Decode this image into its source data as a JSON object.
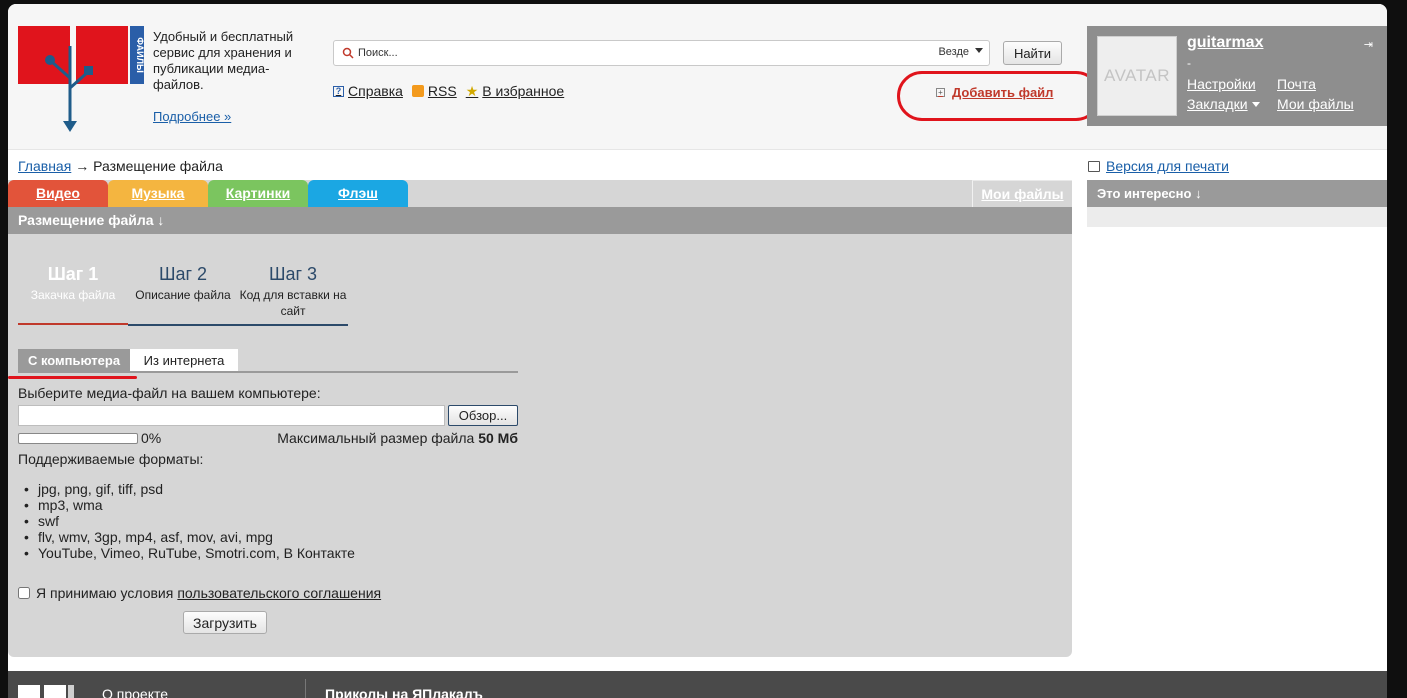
{
  "colors": {
    "accent_red": "#c0392b",
    "highlight_red": "#e0141c",
    "tab_video": "#e2543a",
    "tab_music": "#f4b540",
    "tab_pictures": "#7bc55f",
    "tab_flash": "#1ba7e3",
    "panel_gray": "#9a9a9a",
    "step_blue": "#2c4a6a"
  },
  "header": {
    "logo_side_text": "ФАЙЛЫ",
    "tagline": "Удобный и бесплатный сервис для хранения и публикации медиа-файлов.",
    "more_link": "Подробнее »",
    "search": {
      "placeholder": "Поиск...",
      "scope": "Везде",
      "button": "Найти"
    },
    "quick_links": {
      "help": "Справка",
      "rss": "RSS",
      "favorites": "В избранное"
    },
    "add_file": "Добавить файл"
  },
  "user": {
    "avatar_text": "AVATAR",
    "username": "guitarmax",
    "dash": "-",
    "menu": {
      "settings": "Настройки",
      "mail": "Почта",
      "bookmarks": "Закладки",
      "my_files": "Мои файлы"
    }
  },
  "breadcrumb": {
    "home": "Главная",
    "arrow": "→",
    "current": "Размещение файла"
  },
  "print_link": "Версия для печати",
  "tabs": {
    "video": "Видео",
    "music": "Музыка",
    "pictures": "Картинки",
    "flash": "Флэш",
    "my_files": "Мои файлы"
  },
  "section_title": "Размещение файла ↓",
  "steps": [
    {
      "num": "Шаг 1",
      "desc": "Закачка файла"
    },
    {
      "num": "Шаг 2",
      "desc": "Описание файла"
    },
    {
      "num": "Шаг 3",
      "desc": "Код для вставки на сайт"
    }
  ],
  "source_tabs": {
    "computer": "С компьютера",
    "internet": "Из интернета"
  },
  "upload": {
    "choose_label": "Выберите медиа-файл на вашем компьютере:",
    "browse": "Обзор...",
    "progress": 0,
    "progress_text": "0%",
    "max_size_label": "Максимальный размер файла",
    "max_size_value": "50 Мб",
    "formats_label": "Поддерживаемые форматы:",
    "formats": [
      "jpg, png, gif, tiff, psd",
      "mp3, wma",
      "swf",
      "flv, wmv, 3gp, mp4, asf, mov, avi, mpg",
      "YouTube, Vimeo, RuTube, Smotri.com, В Контакте"
    ],
    "agree_text": "Я принимаю условия",
    "agree_link": "пользовательского соглашения",
    "submit": "Загрузить"
  },
  "sidebar": {
    "interesting": "Это интересно ↓"
  },
  "footer": {
    "about": "О проекте",
    "jokes": "Приколы на ЯПлакалъ"
  }
}
